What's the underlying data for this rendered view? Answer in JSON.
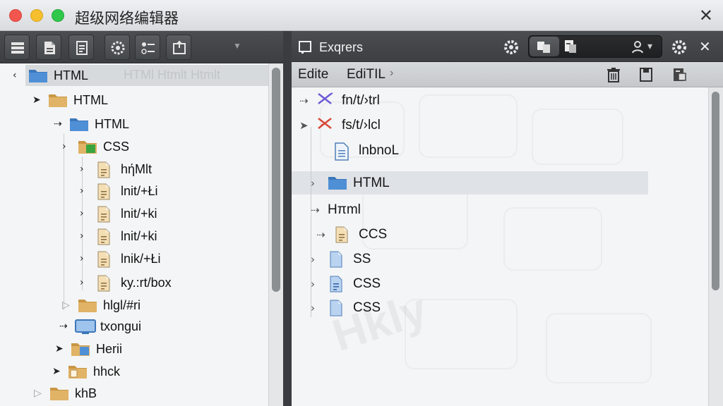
{
  "window": {
    "title": "超级网络编辑器",
    "close_glyph": "✕"
  },
  "left_panel": {
    "toolbar_icons": [
      "list-icon",
      "document-icon",
      "page-icon",
      "settings-icon",
      "toggle-list-icon",
      "export-icon"
    ],
    "dropdown_glyph": "▼",
    "back_glyph": "‹",
    "ghost_text": "HTMl Htmlt   Htmlt",
    "tree": [
      {
        "label": "HTML",
        "icon": "folder-blue",
        "arrow": "back"
      },
      {
        "label": "HTML",
        "icon": "folder-tan",
        "arrow": "right"
      },
      {
        "label": "HTML",
        "icon": "folder-blue",
        "arrow": "dashed"
      },
      {
        "label": "CSS",
        "icon": "folder-green",
        "arrow": "open"
      },
      {
        "label": "hήMlt",
        "icon": "file-tan",
        "arrow": "open"
      },
      {
        "label": "lnit/+Łi",
        "icon": "file-tan",
        "arrow": "open"
      },
      {
        "label": "lnit/+ki",
        "icon": "file-tan",
        "arrow": "open"
      },
      {
        "label": "lnit/+ki",
        "icon": "file-tan",
        "arrow": "open"
      },
      {
        "label": "lnik/+Łi",
        "icon": "file-tan",
        "arrow": "open"
      },
      {
        "label": "ky.:rt/box",
        "icon": "file-tan",
        "arrow": "open"
      },
      {
        "label": "hlgl/#ri",
        "icon": "folder-tan",
        "arrow": "light"
      },
      {
        "label": "txongui",
        "icon": "monitor-blue",
        "arrow": "dashed"
      },
      {
        "label": "Herii",
        "icon": "folder-mixed",
        "arrow": "right"
      },
      {
        "label": "hhck",
        "icon": "folder-file",
        "arrow": "right"
      },
      {
        "label": "khB",
        "icon": "folder-tan",
        "arrow": "light"
      }
    ]
  },
  "right_panel": {
    "title": "Exqrers",
    "toolbar_icons": [
      "window-icon",
      "gear-icon",
      "users-icon",
      "files-icon",
      "user-icon",
      "gear-icon",
      "close-icon"
    ],
    "close_glyph": "✕",
    "user_dropdown_glyph": "▾",
    "sub_toolbar": {
      "edit_label": "Edite",
      "edit2_label": "EdiTIL",
      "more_glyph": "›"
    },
    "watermark": "Hkly",
    "tree": [
      {
        "label": "fn/t/›trl",
        "icon": "cross-purple",
        "arrow": "dashed"
      },
      {
        "label": "fs/t/›lcl",
        "icon": "cross-red",
        "arrow": "right"
      },
      {
        "label": "lnbnoL",
        "icon": "doc-blue",
        "arrow": "none"
      },
      {
        "label": "HTML",
        "icon": "folder-blue",
        "arrow": "open"
      },
      {
        "label": "Hπml",
        "icon": "none",
        "arrow": "dashed"
      },
      {
        "label": "CCS",
        "icon": "file-tan",
        "arrow": "dashed"
      },
      {
        "label": "SS",
        "icon": "file-blue",
        "arrow": "open"
      },
      {
        "label": "CSS",
        "icon": "file-blue-lines",
        "arrow": "open"
      },
      {
        "label": "CSS",
        "icon": "file-blue",
        "arrow": "open"
      }
    ]
  },
  "colors": {
    "folder_blue": "#4f8fd6",
    "folder_tan": "#e0b366",
    "folder_green": "#3aa43f",
    "selection": "#d7dadd"
  }
}
